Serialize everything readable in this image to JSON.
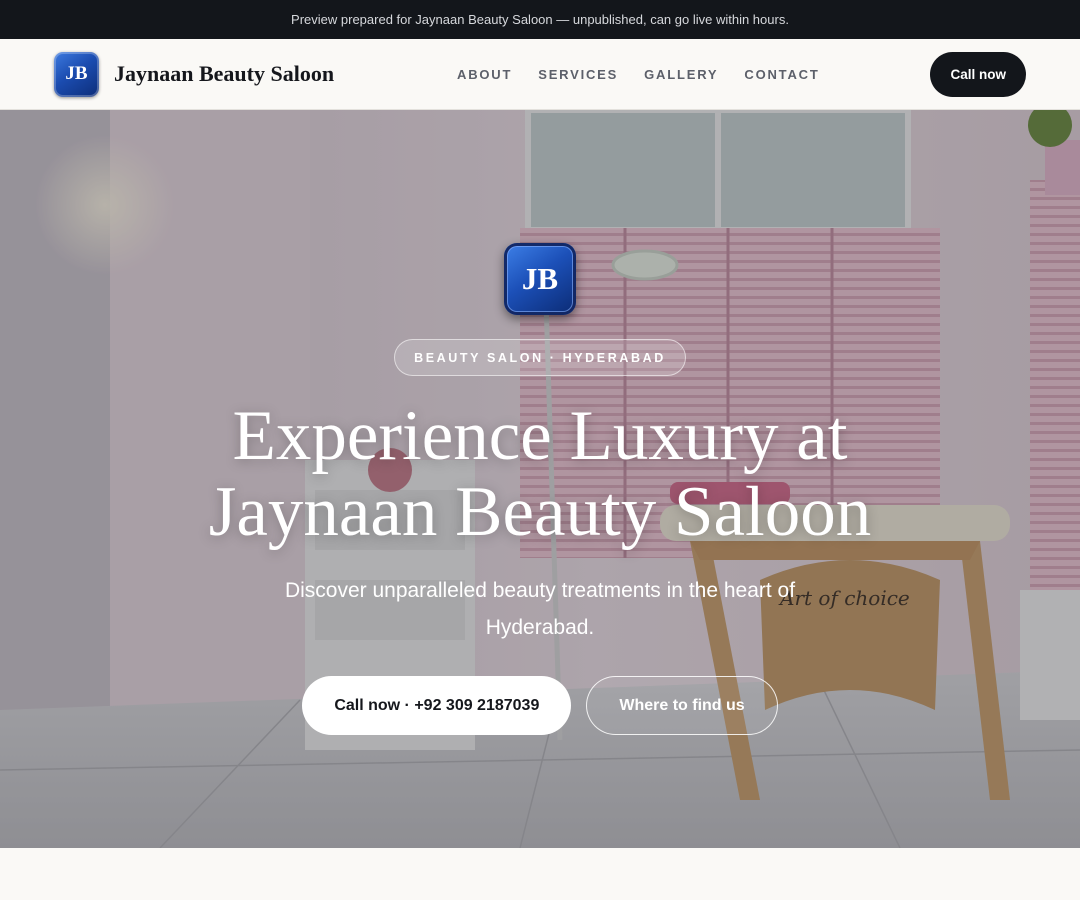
{
  "preview_bar": {
    "text": "Preview prepared for Jaynaan Beauty Saloon — unpublished, can go live within hours."
  },
  "header": {
    "logo_initials": "JB",
    "brand_name": "Jaynaan Beauty Saloon",
    "nav": [
      {
        "label": "ABOUT"
      },
      {
        "label": "SERVICES"
      },
      {
        "label": "GALLERY"
      },
      {
        "label": "CONTACT"
      }
    ],
    "cta_label": "Call now"
  },
  "hero": {
    "logo_initials": "JB",
    "badge": "BEAUTY SALON · HYDERABAD",
    "title_line1": "Experience Luxury at",
    "title_line2": "Jaynaan Beauty Saloon",
    "subtitle": "Discover unparalleled beauty treatments in the heart of Hyderabad.",
    "primary_button": "Call now · +92 309 2187039",
    "secondary_button": "Where to find us",
    "photo_signage": "Art of choice"
  },
  "colors": {
    "dark": "#13161b",
    "brand_blue": "#1c50b8",
    "page_bg": "#faf9f6"
  }
}
